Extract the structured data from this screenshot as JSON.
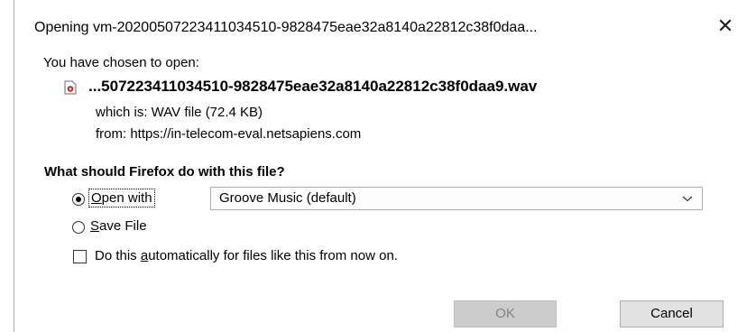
{
  "window": {
    "title": "Opening vm-20200507223411034510-9828475eae32a8140a22812c38f0daa...",
    "close_glyph": "✕"
  },
  "file": {
    "chosen_label": "You have chosen to open:",
    "icon": "audio-file-icon",
    "name": "...507223411034510-9828475eae32a8140a22812c38f0daa9.wav",
    "which_is": "which is:  WAV file (72.4 KB)",
    "from": "from:  https://in-telecom-eval.netsapiens.com"
  },
  "action": {
    "question": "What should Firefox do with this file?",
    "open_with": {
      "label_prefix": "",
      "label_accel": "O",
      "label_rest": "pen with",
      "selected": true
    },
    "app_select": {
      "value": "Groove Music (default)"
    },
    "save_file": {
      "label_accel": "S",
      "label_rest": "ave File",
      "selected": false
    },
    "automatic": {
      "label_prefix": "Do this ",
      "label_accel": "a",
      "label_rest": "utomatically for files like this from now on.",
      "checked": false
    }
  },
  "buttons": {
    "ok": "OK",
    "cancel": "Cancel"
  },
  "colors": {
    "ok_disabled_bg": "#cccccc",
    "ok_disabled_text": "#838383",
    "cancel_bg": "#e1e1e1"
  }
}
